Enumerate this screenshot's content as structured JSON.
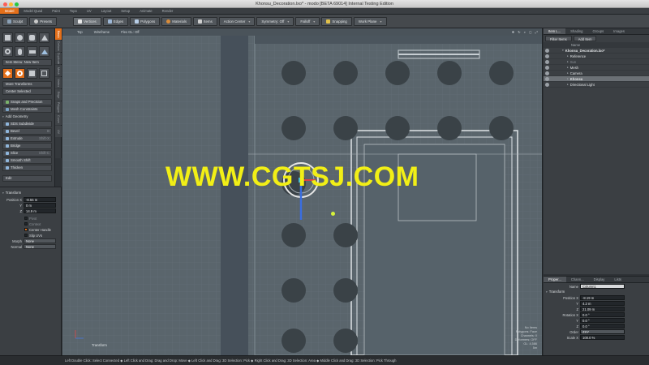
{
  "window": {
    "title": "Khonsu_Decoration.lxo* - modo [BETA 69014] Internal Testing Edition"
  },
  "layout_tabs": [
    "Model",
    "Model Quad",
    "Paint",
    "Topo",
    "UV",
    "Layout",
    "Setup",
    "Animate",
    "Render"
  ],
  "toolbar": {
    "sculpt": "Sculpt",
    "presets": "Presets",
    "modes": [
      "Vertices",
      "Edges",
      "Polygons",
      "Materials",
      "Items"
    ],
    "action_center": "Action Center",
    "symmetry": "Symmetry: Off",
    "falloff": "Falloff",
    "snapping": "Snapping",
    "work_plane": "Work Plane"
  },
  "left_panel": {
    "item_menu": "Item Menu: New Item",
    "more_transforms": "More Transforms",
    "center_selected": "Center Selected",
    "snaps": "Snaps and Precision",
    "mesh_constraints": "Mesh Constraints",
    "add_geometry": "Add Geometry",
    "tools": [
      {
        "label": "SDS Subdivide",
        "hotkey": ""
      },
      {
        "label": "Bevel",
        "hotkey": "B"
      },
      {
        "label": "Extrude",
        "hotkey": "Shift-X"
      },
      {
        "label": "Bridge",
        "hotkey": ""
      },
      {
        "label": "Slice",
        "hotkey": "Shift-C"
      },
      {
        "label": "Smooth Shift",
        "hotkey": ""
      },
      {
        "label": "Thicken",
        "hotkey": ""
      }
    ],
    "edit": "Edit",
    "vtabs": [
      "Basic",
      "Deform",
      "Duplicate",
      "Mesh Edit",
      "Vertex",
      "Edge",
      "Polygon",
      "Curve",
      "UV"
    ]
  },
  "transform_panel": {
    "title": "Transform",
    "position_label": "Position X",
    "x": "-8.55 m",
    "y": "0 m",
    "z": "14.9 m",
    "pivot": "Pivot",
    "context": "Context",
    "center_handle": "Center Handle",
    "slip_uvs": "Slip UVs",
    "morph_label": "Morph",
    "morph_value": "None",
    "normal_label": "Normal",
    "normal_value": "None"
  },
  "viewport": {
    "header": [
      "Top",
      "Wireframe",
      "Flex GL: Off"
    ],
    "watermark": "WWW.CGTSJ.COM",
    "info": [
      "No Items",
      "Polygons: Face",
      "Channels: 0",
      "Deformers: OFF",
      "GL: 4,586",
      "5m"
    ],
    "tool_label": "Transform"
  },
  "item_list": {
    "tabs": [
      "Item L...",
      "Shading",
      "Groups",
      "Images"
    ],
    "filter_label": "Filter Items",
    "add_item_label": "Add Item",
    "column_name": "Name",
    "items": [
      {
        "label": "Khonsu_Decoration.lxo*",
        "indent": 0,
        "selected": false
      },
      {
        "label": "Reference",
        "indent": 1,
        "selected": false
      },
      {
        "label": "Sun",
        "indent": 1,
        "selected": false
      },
      {
        "label": "Mesh",
        "indent": 1,
        "selected": false
      },
      {
        "label": "Camera",
        "indent": 1,
        "selected": false
      },
      {
        "label": "Khonsu",
        "indent": 1,
        "selected": true
      },
      {
        "label": "Directional Light",
        "indent": 1,
        "selected": false
      }
    ]
  },
  "properties": {
    "tabs": [
      "Proper...",
      "Chann...",
      "Display",
      "Lists"
    ],
    "name_label": "Name",
    "name_value": "Column1",
    "section": "Transform",
    "position_label": "Position X",
    "pos_x": "-8.19 m",
    "pos_y": "4.2 m",
    "pos_z": "21.09 m",
    "rotation_label": "Rotation X",
    "rot_x": "0.0 °",
    "rot_y": "0.0 °",
    "rot_z": "0.0 °",
    "order_label": "Order",
    "order_value": "ZXY",
    "scale_label": "Scale X",
    "scale_x": "100.0 %"
  },
  "status_bar": "Left Double Click: Select Connected ◆  Left Click and Drag: Drag and Drop: Move ◆  Left Click and Drag: 3D Selection: Pick ◆  Right Click and Drag: 3D Selection: Area ◆  Middle Click and Drag: 3D Selection: Pick Through",
  "colors": {
    "accent": "#e36f1a",
    "watermark": "#f2ef16",
    "viewport_bg": "#5a656c"
  }
}
